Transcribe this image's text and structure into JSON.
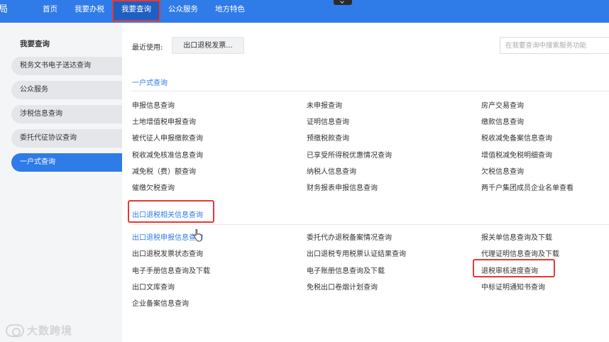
{
  "topbar": {
    "logo_fragment": "局",
    "nav": [
      "首页",
      "我要办税",
      "我要查询",
      "公众服务",
      "地方特色"
    ],
    "active_index": 2
  },
  "sidebar": {
    "title": "我要查询",
    "items": [
      "税务文书电子送达查询",
      "公众服务",
      "涉税信息查询",
      "委托代征协议查询",
      "一户式查询"
    ],
    "active_index": 4
  },
  "main": {
    "recent_label": "最近使用:",
    "recent_chip": "出口退税发票...",
    "search_placeholder": "在我要查询中搜索服务功能",
    "sections": [
      {
        "title": "一户式查询",
        "rows": [
          [
            "申报信息查询",
            "未申报查询",
            "房产交易查询"
          ],
          [
            "土地增值税申报查询",
            "证明信息查询",
            "缴款信息查询"
          ],
          [
            "被代征人申报缴款查询",
            "预缴税款查询",
            "税收减免备案信息查询"
          ],
          [
            "税收减免核准信息查询",
            "已享受所得税优惠情况查询",
            "增值税减免税明细查询"
          ],
          [
            "减免税（费）额查询",
            "纳税人信息查询",
            "欠税信息查询"
          ],
          [
            "催缴欠税查询",
            "财务报表申报信息查询",
            "两千户集团成员企业名单查看"
          ]
        ]
      },
      {
        "title": "出口退税相关信息查询",
        "rows": [
          [
            "出口退税申报信息查询",
            "委托代办退税备案情况查询",
            "报关单信息查询及下载"
          ],
          [
            "出口退税发票状态查询",
            "出口退税专用税票认证结果查询",
            "代理证明信息查询及下载"
          ],
          [
            "电子手册信息查询及下载",
            "电子账册信息查询及下载",
            "退税审核进度查询"
          ],
          [
            "出口文库查询",
            "免税出口卷烟计划查询",
            "中标证明通知书查询"
          ],
          [
            "企业备案信息查询",
            "",
            ""
          ]
        ]
      }
    ]
  },
  "watermark": "大数跨境",
  "colors": {
    "primary": "#2f7be8",
    "highlight": "#e53935"
  }
}
